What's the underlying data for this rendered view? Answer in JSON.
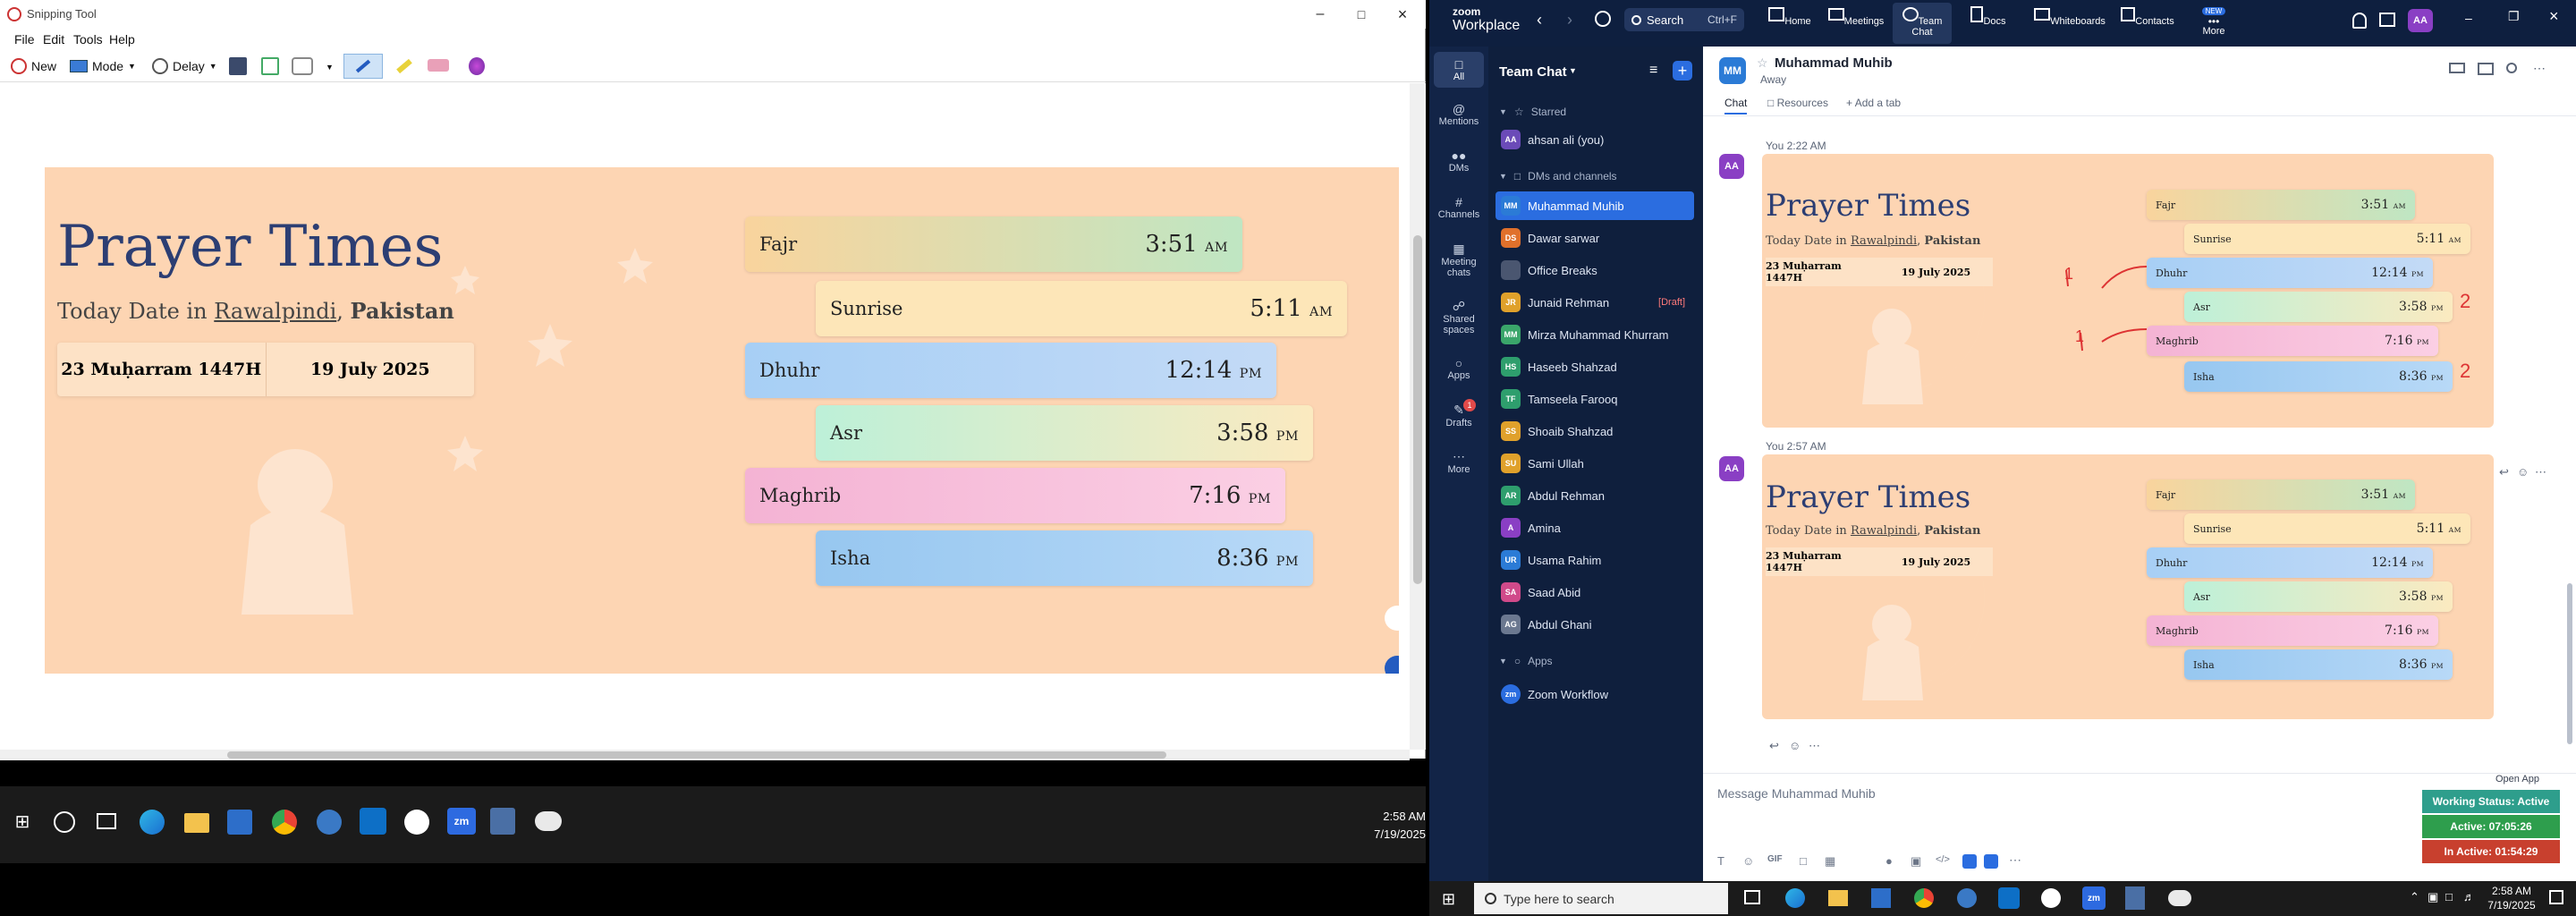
{
  "snip": {
    "title": "Snipping Tool",
    "menu": [
      "File",
      "Edit",
      "Tools",
      "Help"
    ],
    "toolbar": {
      "new": "New",
      "mode": "Mode",
      "delay": "Delay"
    }
  },
  "prayer": {
    "title": "Prayer Times",
    "date_prefix": "Today Date in",
    "city": "Rawalpindi",
    "country": "Pakistan",
    "hijri": "23 Muḥarram 1447H",
    "gregorian": "19 July 2025",
    "times": [
      {
        "name": "Fajr",
        "time": "3:51",
        "ampm": "AM"
      },
      {
        "name": "Sunrise",
        "time": "5:11",
        "ampm": "AM"
      },
      {
        "name": "Dhuhr",
        "time": "12:14",
        "ampm": "PM"
      },
      {
        "name": "Asr",
        "time": "3:58",
        "ampm": "PM"
      },
      {
        "name": "Maghrib",
        "time": "7:16",
        "ampm": "PM"
      },
      {
        "name": "Isha",
        "time": "8:36",
        "ampm": "PM"
      }
    ]
  },
  "taskbar_left": {
    "time": "2:58 AM",
    "date": "7/19/2025"
  },
  "zoom": {
    "brand_top": "zoom",
    "brand_bottom": "Workplace",
    "search": "Search",
    "search_shortcut": "Ctrl+F",
    "nav": [
      "Home",
      "Meetings",
      "Team Chat",
      "Docs",
      "Whiteboards",
      "Contacts",
      "More"
    ],
    "nav_new": "NEW",
    "user_initials": "AA",
    "rail": [
      {
        "label": "All"
      },
      {
        "label": "Mentions"
      },
      {
        "label": "DMs"
      },
      {
        "label": "Channels"
      },
      {
        "label": "Meeting chats"
      },
      {
        "label": "Shared spaces"
      },
      {
        "label": "Apps"
      },
      {
        "label": "Drafts",
        "badge": "1"
      },
      {
        "label": "More"
      }
    ],
    "sidebar_title": "Team Chat",
    "starred": "Starred",
    "dms_channels": "DMs and channels",
    "apps_section": "Apps",
    "contacts": [
      {
        "name": "ahsan ali (you)",
        "init": "AA",
        "color": "#6b4bb8"
      },
      {
        "name": "Muhammad Muhib",
        "init": "MM",
        "color": "#2b7bd6",
        "active": true
      },
      {
        "name": "Dawar sarwar",
        "init": "DS",
        "color": "#e0702b"
      },
      {
        "name": "Office Breaks",
        "init": "",
        "color": "#4a5670"
      },
      {
        "name": "Junaid Rehman",
        "init": "JR",
        "color": "#e0a12b",
        "draft": "[Draft]"
      },
      {
        "name": "Mirza Muhammad Khurram",
        "init": "MM",
        "color": "#3aa56a"
      },
      {
        "name": "Haseeb Shahzad",
        "init": "HS",
        "color": "#2e9e6d"
      },
      {
        "name": "Tamseela Farooq",
        "init": "TF",
        "color": "#2e9e6d"
      },
      {
        "name": "Shoaib Shahzad",
        "init": "SS",
        "color": "#e0a12b"
      },
      {
        "name": "Sami Ullah",
        "init": "SU",
        "color": "#e0a12b"
      },
      {
        "name": "Abdul Rehman",
        "init": "AR",
        "color": "#2e9e6d"
      },
      {
        "name": "Amina",
        "init": "A",
        "color": "#8a3fc4"
      },
      {
        "name": "Usama Rahim",
        "init": "UR",
        "color": "#2b7bd6"
      },
      {
        "name": "Saad Abid",
        "init": "SA",
        "color": "#d04a8a"
      },
      {
        "name": "Abdul Ghani",
        "init": "AG",
        "color": "#6b7890"
      }
    ],
    "zoom_workflow": "Zoom Workflow",
    "chat_header": {
      "name": "Muhammad Muhib",
      "initials": "MM",
      "status": "Away"
    },
    "tabs": [
      "Chat",
      "Resources",
      "Add a tab"
    ],
    "msg1_meta": "You 2:22 AM",
    "msg2_meta": "You 2:57 AM",
    "composer_placeholder": "Message Muhammad Muhib",
    "open_app": "Open App",
    "working_status": "Working Status: Active",
    "active_time": "Active: 07:05:26",
    "inactive_time": "In Active: 01:54:29",
    "annotation_marks": [
      "1",
      "1",
      "2",
      "2"
    ]
  },
  "taskbar_right": {
    "search_placeholder": "Type here to search",
    "time": "2:58 AM",
    "date": "7/19/2025"
  }
}
